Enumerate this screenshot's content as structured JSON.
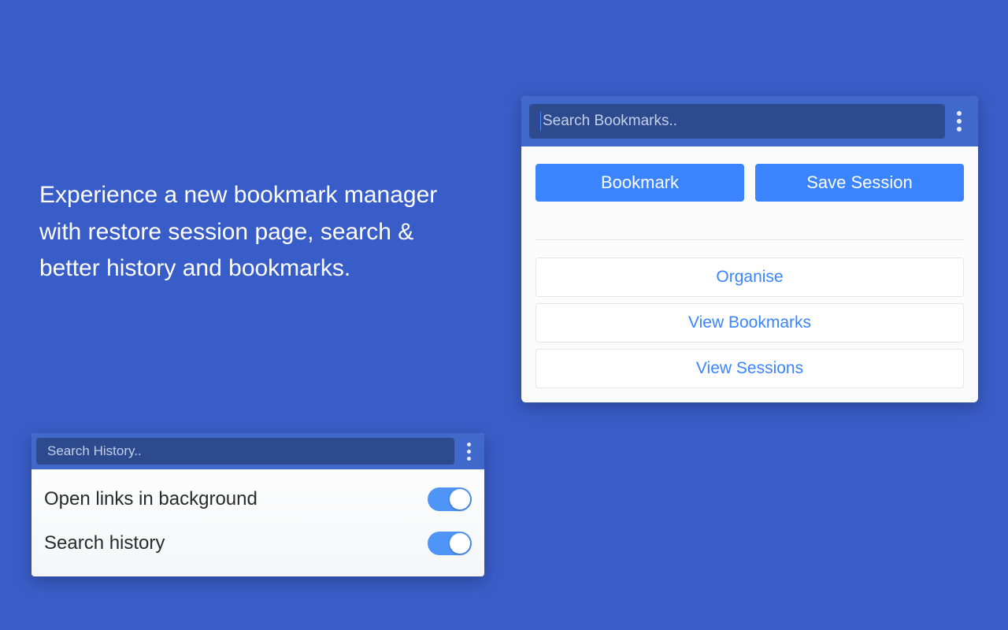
{
  "headline": "Experience a new bookmark manager with restore session page, search & better history and bookmarks.",
  "bookmarks_panel": {
    "search_placeholder": "Search Bookmarks..",
    "primary_buttons": {
      "bookmark": "Bookmark",
      "save_session": "Save Session"
    },
    "links": {
      "organise": "Organise",
      "view_bookmarks": "View Bookmarks",
      "view_sessions": "View Sessions"
    }
  },
  "history_panel": {
    "search_placeholder": "Search History..",
    "settings": [
      {
        "label": "Open links in background",
        "on": true
      },
      {
        "label": "Search history",
        "on": true
      }
    ]
  },
  "colors": {
    "background": "#395dc8",
    "header": "#4169cc",
    "searchBox": "#2e4a8f",
    "primaryBtn": "#3a84ff",
    "linkText": "#3a84ff"
  }
}
